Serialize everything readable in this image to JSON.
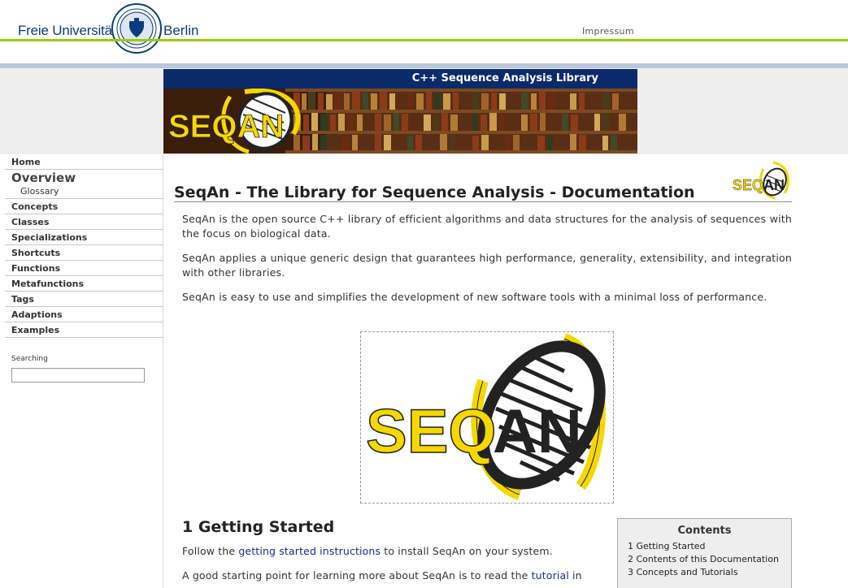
{
  "header": {
    "university_left": "Freie Universität",
    "university_right": "Berlin",
    "impressum": "Impressum",
    "banner_title": "C++ Sequence Analysis Library",
    "logo_text": "SEQAN"
  },
  "sidebar": {
    "items": [
      {
        "label": "Home"
      },
      {
        "label": "Overview"
      },
      {
        "label": "Glossary"
      },
      {
        "label": "Concepts"
      },
      {
        "label": "Classes"
      },
      {
        "label": "Specializations"
      },
      {
        "label": "Shortcuts"
      },
      {
        "label": "Functions"
      },
      {
        "label": "Metafunctions"
      },
      {
        "label": "Tags"
      },
      {
        "label": "Adaptions"
      },
      {
        "label": "Examples"
      }
    ],
    "search_label": "Searching",
    "search_value": ""
  },
  "content": {
    "title": "SeqAn - The Library for Sequence Analysis - Documentation",
    "paragraphs": [
      "SeqAn is the open source C++ library of efficient algorithms and data structures for the analysis of sequences with the focus on biological data.",
      "SeqAn applies a unique generic design that guarantees high performance, generality, extensibility, and integration with other libraries.",
      "SeqAn is easy to use and simplifies the development of new software tools with a minimal loss of performance."
    ],
    "section_title": "1 Getting Started",
    "getting_started": {
      "pre": "Follow the ",
      "link": "getting started instructions",
      "post": " to install SeqAn on your system."
    },
    "tutorial_line": {
      "pre": "A good starting point for learning more about SeqAn is to read the ",
      "link": "tutorial",
      "post": " in"
    }
  },
  "toc": {
    "title": "Contents",
    "items": [
      "1 Getting Started",
      "2 Contents of this Documentation",
      "3 Concepts and Tutorials"
    ]
  },
  "colors": {
    "fu_blue": "#0b3d7e",
    "fu_green": "#99cc00",
    "banner_navy": "#0b2a6b",
    "seqan_yellow": "#f5d800",
    "link": "#1a2a8a"
  }
}
